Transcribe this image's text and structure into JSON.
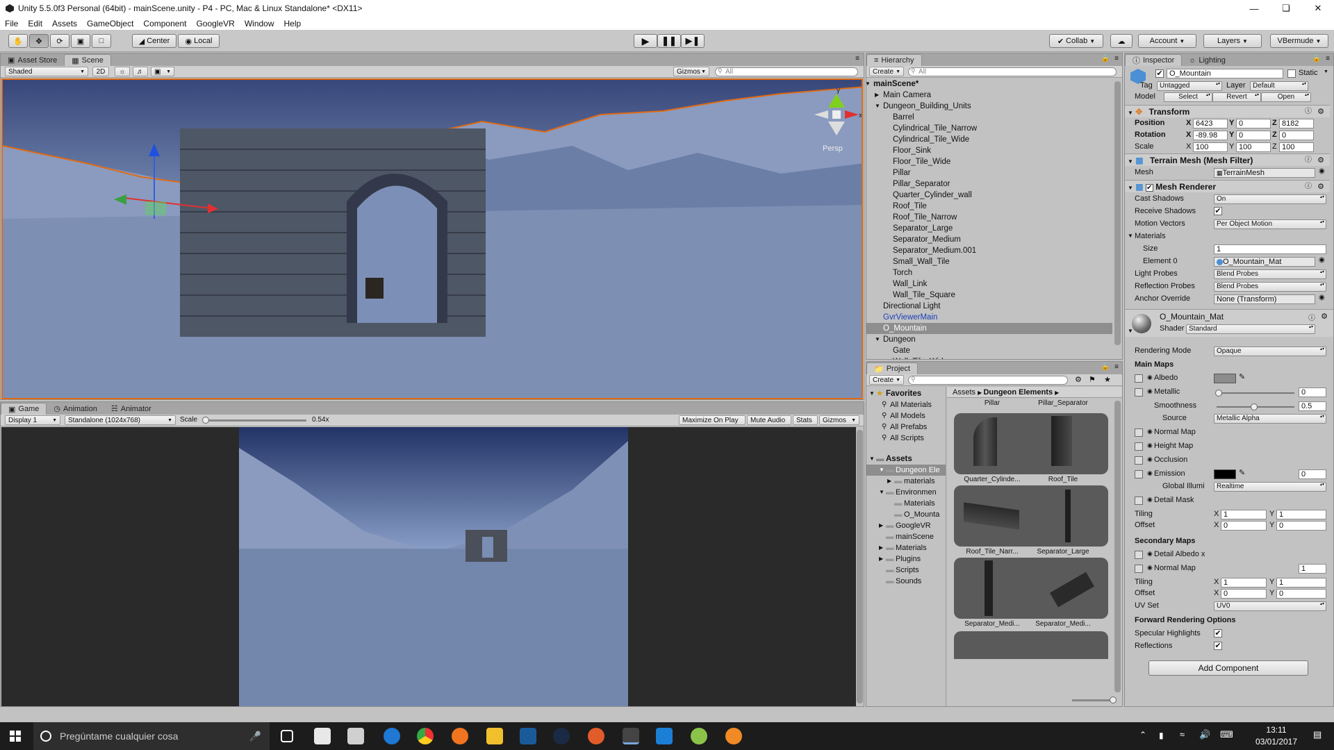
{
  "window": {
    "title": "Unity 5.5.0f3 Personal (64bit) - mainScene.unity - P4 - PC, Mac & Linux Standalone* <DX11>"
  },
  "menu": [
    "File",
    "Edit",
    "Assets",
    "GameObject",
    "Component",
    "GoogleVR",
    "Window",
    "Help"
  ],
  "toolbar": {
    "center": "Center",
    "local": "Local",
    "collab": "Collab",
    "account": "Account",
    "layers": "Layers",
    "layout": "VBermude"
  },
  "scene_panel": {
    "tabs": [
      "Asset Store",
      "Scene"
    ],
    "shading": "Shaded",
    "mode_2d": "2D",
    "gizmos": "Gizmos",
    "search_placeholder": "All",
    "persp": "Persp"
  },
  "game_panel": {
    "tabs": [
      "Game",
      "Animation",
      "Animator"
    ],
    "display": "Display 1",
    "resolution": "Standalone (1024x768)",
    "scale_label": "Scale",
    "scale_value": "0.54x",
    "scale_fraction": 0.54,
    "maximize": "Maximize On Play",
    "mute": "Mute Audio",
    "stats": "Stats",
    "gizmos": "Gizmos"
  },
  "hierarchy": {
    "tab": "Hierarchy",
    "create": "Create",
    "search_placeholder": "All",
    "items": [
      {
        "label": "mainScene*",
        "level": 0,
        "arrow": "down",
        "bold": true
      },
      {
        "label": "Main Camera",
        "level": 1,
        "arrow": "right"
      },
      {
        "label": "Dungeon_Building_Units",
        "level": 1,
        "arrow": "down"
      },
      {
        "label": "Barrel",
        "level": 2
      },
      {
        "label": "Cylindrical_Tile_Narrow",
        "level": 2
      },
      {
        "label": "Cylindrical_Tile_Wide",
        "level": 2
      },
      {
        "label": "Floor_Sink",
        "level": 2
      },
      {
        "label": "Floor_Tile_Wide",
        "level": 2
      },
      {
        "label": "Pillar",
        "level": 2
      },
      {
        "label": "Pillar_Separator",
        "level": 2
      },
      {
        "label": "Quarter_Cylinder_wall",
        "level": 2
      },
      {
        "label": "Roof_Tile",
        "level": 2
      },
      {
        "label": "Roof_Tile_Narrow",
        "level": 2
      },
      {
        "label": "Separator_Large",
        "level": 2
      },
      {
        "label": "Separator_Medium",
        "level": 2
      },
      {
        "label": "Separator_Medium.001",
        "level": 2
      },
      {
        "label": "Small_Wall_Tile",
        "level": 2
      },
      {
        "label": "Torch",
        "level": 2
      },
      {
        "label": "Wall_Link",
        "level": 2
      },
      {
        "label": "Wall_Tile_Square",
        "level": 2
      },
      {
        "label": "Directional Light",
        "level": 1
      },
      {
        "label": "GvrViewerMain",
        "level": 1,
        "color": "blue"
      },
      {
        "label": "O_Mountain",
        "level": 1,
        "selected": true
      },
      {
        "label": "Dungeon",
        "level": 1,
        "arrow": "down"
      },
      {
        "label": "Gate",
        "level": 2
      },
      {
        "label": "Wall_Tile_Wide",
        "level": 2
      }
    ]
  },
  "project": {
    "tab": "Project",
    "create": "Create",
    "breadcrumb": [
      "Assets",
      "Dungeon Elements"
    ],
    "favorites_label": "Favorites",
    "favorites": [
      "All Materials",
      "All Models",
      "All Prefabs",
      "All Scripts"
    ],
    "assets_label": "Assets",
    "tree": [
      {
        "label": "Dungeon Ele",
        "level": 1,
        "arrow": "down",
        "selected": true
      },
      {
        "label": "materials",
        "level": 2,
        "arrow": "right"
      },
      {
        "label": "Environmen",
        "level": 1,
        "arrow": "down"
      },
      {
        "label": "Materials",
        "level": 2
      },
      {
        "label": "O_Mounta",
        "level": 2
      },
      {
        "label": "GoogleVR",
        "level": 1,
        "arrow": "right"
      },
      {
        "label": "mainScene",
        "level": 1
      },
      {
        "label": "Materials",
        "level": 1,
        "arrow": "right"
      },
      {
        "label": "Plugins",
        "level": 1,
        "arrow": "right"
      },
      {
        "label": "Scripts",
        "level": 1
      },
      {
        "label": "Sounds",
        "level": 1
      }
    ],
    "grid_top_labels": [
      "Pillar",
      "Pillar_Separator"
    ],
    "grid": [
      [
        "Quarter_Cylinde...",
        "Roof_Tile"
      ],
      [
        "Roof_Tile_Narr...",
        "Separator_Large"
      ],
      [
        "Separator_Medi...",
        "Separator_Medi..."
      ]
    ]
  },
  "inspector": {
    "tabs": [
      "Inspector",
      "Lighting"
    ],
    "name": "O_Mountain",
    "static_label": "Static",
    "tag_label": "Tag",
    "tag": "Untagged",
    "layer_label": "Layer",
    "layer": "Default",
    "model_label": "Model",
    "model_buttons": [
      "Select",
      "Revert",
      "Open"
    ],
    "transform": {
      "title": "Transform",
      "position_label": "Position",
      "position": [
        "6423",
        "0",
        "8182"
      ],
      "rotation_label": "Rotation",
      "rotation": [
        "-89.98",
        "0",
        "0"
      ],
      "scale_label": "Scale",
      "scale": [
        "100",
        "100",
        "100"
      ],
      "axes": [
        "X",
        "Y",
        "Z"
      ]
    },
    "mesh_filter": {
      "title": "Terrain Mesh (Mesh Filter)",
      "mesh_label": "Mesh",
      "mesh": "TerrainMesh"
    },
    "mesh_renderer": {
      "title": "Mesh Renderer",
      "cast_shadows_label": "Cast Shadows",
      "cast_shadows": "On",
      "receive_shadows_label": "Receive Shadows",
      "motion_vectors_label": "Motion Vectors",
      "motion_vectors": "Per Object Motion",
      "materials_label": "Materials",
      "size_label": "Size",
      "size": "1",
      "element0_label": "Element 0",
      "element0": "O_Mountain_Mat",
      "light_probes_label": "Light Probes",
      "light_probes": "Blend Probes",
      "reflection_probes_label": "Reflection Probes",
      "reflection_probes": "Blend Probes",
      "anchor_label": "Anchor Override",
      "anchor": "None (Transform)"
    },
    "material": {
      "name": "O_Mountain_Mat",
      "shader_label": "Shader",
      "shader": "Standard",
      "rendering_mode_label": "Rendering Mode",
      "rendering_mode": "Opaque",
      "main_maps_label": "Main Maps",
      "albedo_label": "Albedo",
      "metallic_label": "Metallic",
      "metallic": "0",
      "metallic_fraction": 0,
      "smoothness_label": "Smoothness",
      "smoothness": "0.5",
      "smoothness_fraction": 0.5,
      "source_label": "Source",
      "source": "Metallic Alpha",
      "normal_map_label": "Normal Map",
      "height_map_label": "Height Map",
      "occlusion_label": "Occlusion",
      "emission_label": "Emission",
      "emission": "0",
      "gi_label": "Global Illumi",
      "gi": "Realtime",
      "detail_mask_label": "Detail Mask",
      "tiling_label": "Tiling",
      "tiling": [
        "1",
        "1"
      ],
      "offset_label": "Offset",
      "offset": [
        "0",
        "0"
      ],
      "secondary_label": "Secondary Maps",
      "detail_albedo_label": "Detail Albedo x",
      "normal_map2_label": "Normal Map",
      "normal_map2": "1",
      "tiling2": [
        "1",
        "1"
      ],
      "offset2": [
        "0",
        "0"
      ],
      "uv_label": "UV Set",
      "uv": "UV0",
      "forward_label": "Forward Rendering Options",
      "specular_label": "Specular Highlights",
      "reflections_label": "Reflections",
      "xy": [
        "X",
        "Y"
      ]
    },
    "add_component": "Add Component"
  },
  "taskbar": {
    "search": "Pregúntame cualquier cosa",
    "time": "13:11",
    "date": "03/01/2017"
  }
}
